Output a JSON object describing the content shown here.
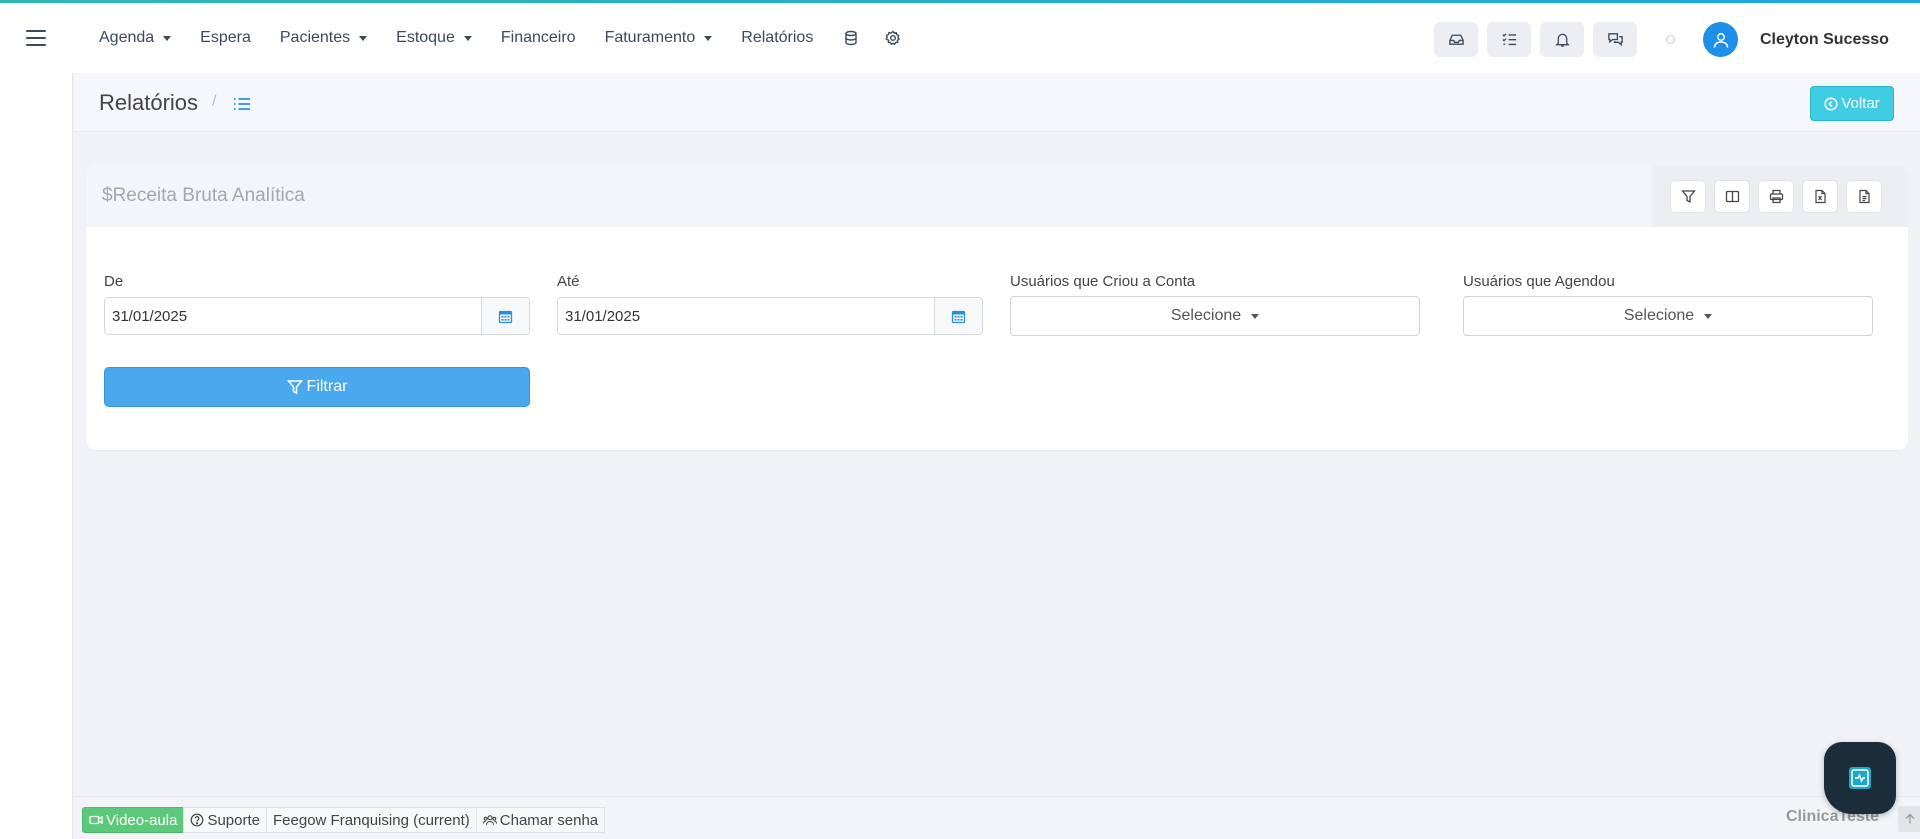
{
  "nav": {
    "items": [
      {
        "label": "Agenda",
        "has_caret": true
      },
      {
        "label": "Espera",
        "has_caret": false
      },
      {
        "label": "Pacientes",
        "has_caret": true
      },
      {
        "label": "Estoque",
        "has_caret": true
      },
      {
        "label": "Financeiro",
        "has_caret": false
      },
      {
        "label": "Faturamento",
        "has_caret": true
      },
      {
        "label": "Relatórios",
        "has_caret": false
      }
    ],
    "icons": [
      "database-icon",
      "gear-icon"
    ],
    "right_buttons": [
      "inbox-icon",
      "task-list-icon",
      "bell-icon",
      "chat-bubbles-icon"
    ],
    "user_name": "Cleyton Sucesso"
  },
  "breadcrumb": {
    "title": "Relatórios",
    "separator": "/",
    "back_label": "Voltar"
  },
  "report": {
    "title": "$Receita Bruta Analítica",
    "tools": [
      "filter-icon",
      "columns-icon",
      "print-icon",
      "excel-export-icon",
      "pdf-export-icon"
    ],
    "fields": {
      "from_label": "De",
      "from_value": "31/01/2025",
      "to_label": "Até",
      "to_value": "31/01/2025",
      "created_by_label": "Usuários que Criou a Conta",
      "created_by_value": "Selecione",
      "scheduled_by_label": "Usuários que Agendou",
      "scheduled_by_value": "Selecione"
    },
    "filter_label": "Filtrar"
  },
  "footer": {
    "video_label": "Video-aula",
    "support_label": "Suporte",
    "franchise_label": "Feegow Franquising (current)",
    "call_label": "Chamar senha",
    "clinic_name": "ClinicaTeste"
  },
  "colors": {
    "accent": "#1ea7e1",
    "primary_button": "#4aa8ef",
    "back_button": "#3ecde4",
    "video_button": "#5cc87a",
    "avatar": "#1e90e8"
  }
}
